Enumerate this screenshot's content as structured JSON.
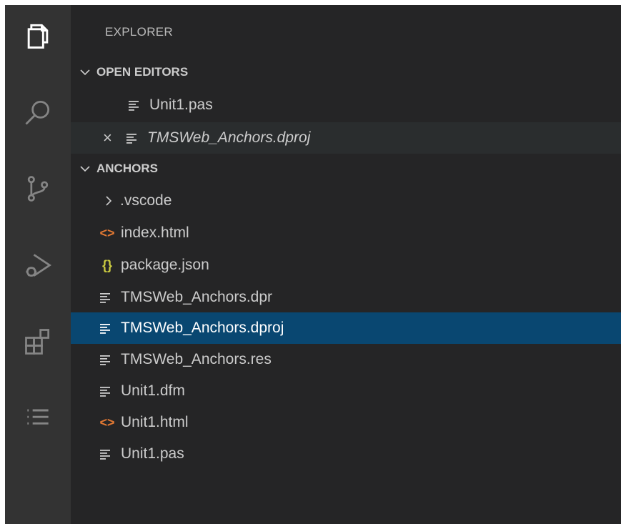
{
  "sidebar": {
    "title": "EXPLORER",
    "open_editors": {
      "header": "OPEN EDITORS",
      "items": [
        {
          "label": "Unit1.pas",
          "icon": "lines-icon"
        },
        {
          "label": "TMSWeb_Anchors.dproj",
          "icon": "lines-icon",
          "close": "×"
        }
      ]
    },
    "folder": {
      "header": "ANCHORS",
      "items": [
        {
          "label": ".vscode",
          "icon": "chevron-right-icon"
        },
        {
          "label": "index.html",
          "icon": "angle-brackets-icon",
          "glyph": "<>"
        },
        {
          "label": "package.json",
          "icon": "curly-braces-icon",
          "glyph": "{}"
        },
        {
          "label": "TMSWeb_Anchors.dpr",
          "icon": "lines-icon"
        },
        {
          "label": "TMSWeb_Anchors.dproj",
          "icon": "lines-icon"
        },
        {
          "label": "TMSWeb_Anchors.res",
          "icon": "lines-icon"
        },
        {
          "label": "Unit1.dfm",
          "icon": "lines-icon"
        },
        {
          "label": "Unit1.html",
          "icon": "angle-brackets-icon",
          "glyph": "<>"
        },
        {
          "label": "Unit1.pas",
          "icon": "lines-icon"
        }
      ]
    }
  },
  "activity_bar": {
    "icons": [
      "explorer-icon",
      "search-icon",
      "source-control-icon",
      "run-debug-icon",
      "extensions-icon",
      "list-icon"
    ]
  },
  "colors": {
    "activity_bar": "#333333",
    "sidebar": "#252526",
    "selection": "#094771",
    "hover": "#2a2d2e",
    "html_icon": "#e37933",
    "json_icon": "#cbcb41"
  }
}
